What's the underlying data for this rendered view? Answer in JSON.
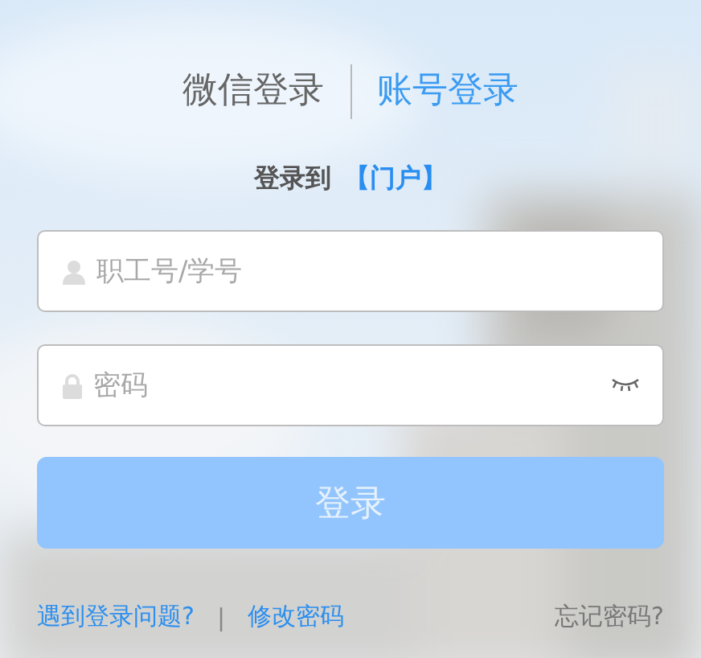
{
  "tabs": [
    {
      "label": "微信登录",
      "selected": false
    },
    {
      "label": "账号登录",
      "selected": true
    }
  ],
  "heading": {
    "text": "登录到",
    "target": "【门户】"
  },
  "fields": [
    {
      "kind": "text",
      "placeholder": "职工号/学号"
    },
    {
      "kind": "password",
      "placeholder": "密码"
    }
  ],
  "login_button": {
    "label": "登录",
    "disabled": true
  },
  "links": [
    {
      "label": "遇到登录问题?"
    },
    {
      "label": "修改密码"
    }
  ],
  "separator": "|",
  "forgot_link": {
    "label": "忘记密码?"
  }
}
